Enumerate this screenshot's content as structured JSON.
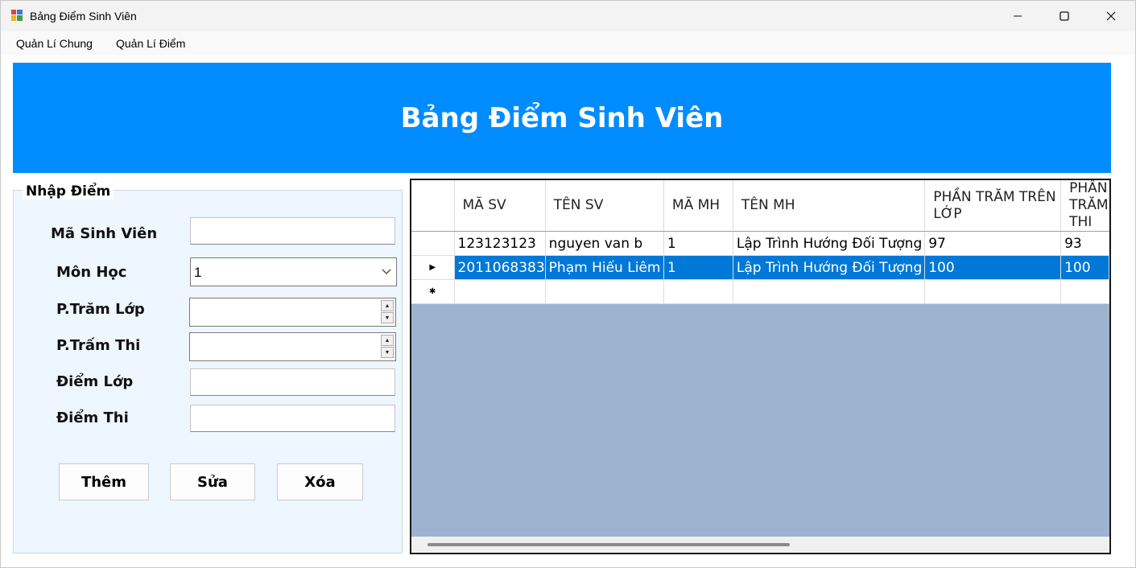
{
  "window": {
    "title": "Bảng Điểm Sinh Viên",
    "controls": {
      "minimize": "—",
      "maximize": "☐",
      "close": "✕"
    }
  },
  "menu": {
    "items": [
      "Quản Lí Chung",
      "Quản Lí Điểm"
    ]
  },
  "header": {
    "title": "Bảng Điểm Sinh Viên",
    "color": "#008cff"
  },
  "form": {
    "group_title": "Nhập Điểm",
    "labels": {
      "ma_sinh_vien": "Mã Sinh Viên",
      "mon_hoc": "Môn Học",
      "p_tram_lop": "P.Trăm Lớp",
      "p_tram_thi": "P.Trấm Thi",
      "diem_lop": "Điểm Lớp",
      "diem_thi": "Điểm Thi"
    },
    "values": {
      "mon_hoc": "1"
    },
    "buttons": {
      "them": "Thêm",
      "sua": "Sửa",
      "xoa": "Xóa"
    }
  },
  "grid": {
    "headers": [
      "MÃ SV",
      "TÊN SV",
      "MÃ MH",
      "TÊN MH",
      "PHẦN TRĂM TRÊN LỚP",
      "PHẦN TRĂM THI"
    ],
    "rows": [
      [
        "123123123",
        "nguyen van b",
        "1",
        "Lập Trình Hướng Đối Tượng",
        "97",
        "93"
      ],
      [
        "2011068383",
        "Phạm Hiếu Liêm",
        "1",
        "Lập Trình Hướng Đối Tượng",
        "100",
        "100"
      ]
    ],
    "selected_row": 1,
    "selection_color": "#0078d7"
  }
}
